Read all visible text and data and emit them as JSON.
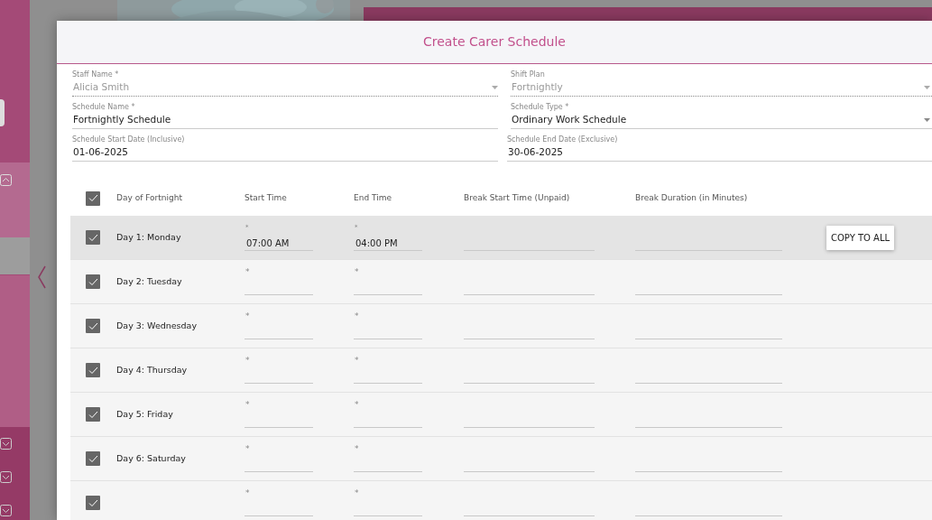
{
  "dialog": {
    "title": "Create Carer Schedule",
    "fields": [
      {
        "label": "Staff Name *",
        "value": "Alicia Smith",
        "kind": "select",
        "disabled": true
      },
      {
        "label": "Shift Plan",
        "value": "Fortnightly",
        "kind": "select",
        "disabled": true
      },
      {
        "label": "Schedule Name *",
        "value": "Fortnightly Schedule",
        "kind": "text",
        "disabled": false
      },
      {
        "label": "Schedule Type *",
        "value": "Ordinary Work Schedule",
        "kind": "select",
        "disabled": false
      },
      {
        "label": "Schedule Start Date (Inclusive)",
        "value": "01-06-2025",
        "kind": "date",
        "disabled": false
      },
      {
        "label": "Schedule End Date (Exclusive)",
        "value": "30-06-2025",
        "kind": "date",
        "disabled": false
      }
    ],
    "table": {
      "all_checked": true,
      "columns": [
        "Day of Fortnight",
        "Start Time",
        "End Time",
        "Break Start Time (Unpaid)",
        "Break Duration (in Minutes)"
      ],
      "rows": [
        {
          "day": "Day 1: Monday",
          "checked": true,
          "highlighted": true,
          "start_mark": "*",
          "start_time": "07:00 AM",
          "end_mark": "*",
          "end_time": "04:00 PM",
          "copy_button": "COPY TO ALL"
        },
        {
          "day": "Day 2: Tuesday",
          "checked": true,
          "highlighted": false,
          "start_mark": "*",
          "end_mark": "*"
        },
        {
          "day": "Day 3: Wednesday",
          "checked": true,
          "highlighted": false,
          "start_mark": "*",
          "end_mark": "*"
        },
        {
          "day": "Day 4: Thursday",
          "checked": true,
          "highlighted": false,
          "start_mark": "*",
          "end_mark": "*"
        },
        {
          "day": "Day 5: Friday",
          "checked": true,
          "highlighted": false,
          "start_mark": "*",
          "end_mark": "*"
        },
        {
          "day": "Day 6: Saturday",
          "checked": true,
          "highlighted": false,
          "start_mark": "*",
          "end_mark": "*"
        },
        {
          "checked": true,
          "highlighted": false,
          "start_mark": "*",
          "end_mark": "*"
        }
      ]
    }
  }
}
